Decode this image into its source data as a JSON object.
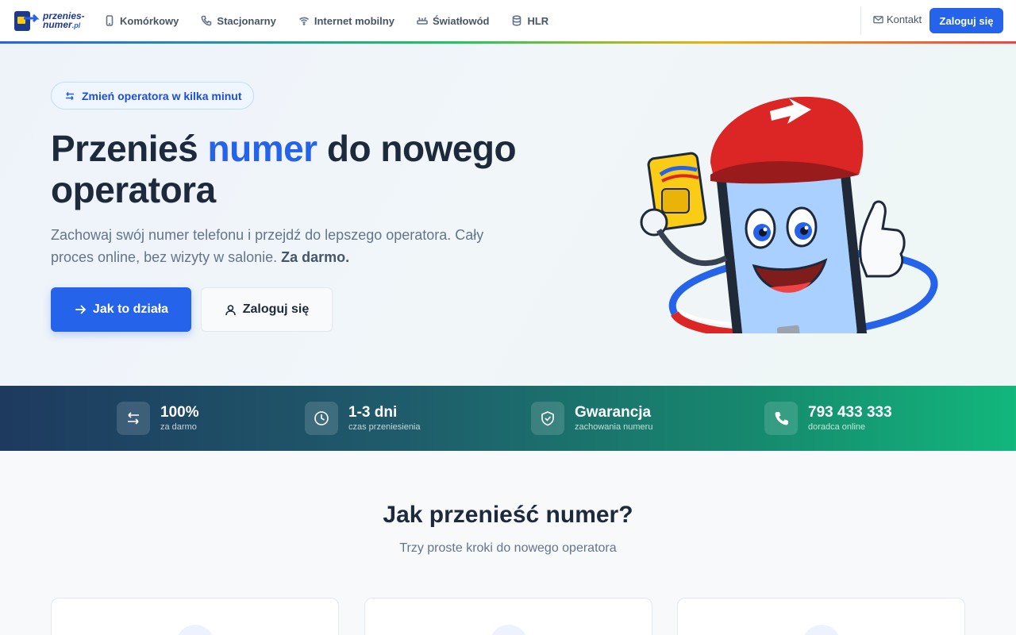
{
  "brand": {
    "logo_line1": "przenies-",
    "logo_line2": "numer",
    "logo_tld": ".pl"
  },
  "nav": {
    "links": [
      {
        "label": "Komórkowy",
        "icon": "mobile-phone-icon"
      },
      {
        "label": "Stacjonarny",
        "icon": "landline-phone-icon"
      },
      {
        "label": "Internet mobilny",
        "icon": "wifi-icon"
      },
      {
        "label": "Światłowód",
        "icon": "router-icon"
      },
      {
        "label": "HLR",
        "icon": "database-icon"
      }
    ],
    "contact_label": "Kontakt",
    "login_label": "Zaloguj się"
  },
  "hero": {
    "badge": "Zmień operatora w kilka minut",
    "title_part1": "Przenieś ",
    "title_accent": "numer",
    "title_part2": " do nowego operatora",
    "subtitle": "Zachowaj swój numer telefonu i przejdź do lepszego operatora. Cały proces online, bez wizyty w salonie. ",
    "subtitle_bold": "Za darmo.",
    "primary_button": "Jak to działa",
    "secondary_button": "Zaloguj się"
  },
  "stats": [
    {
      "value": "100%",
      "label": "za darmo",
      "icon": "swap-arrows-icon"
    },
    {
      "value": "1-3 dni",
      "label": "czas przeniesienia",
      "icon": "clock-icon"
    },
    {
      "value": "Gwarancja",
      "label": "zachowania numeru",
      "icon": "shield-check-icon"
    },
    {
      "value": "793 433 333",
      "label": "doradca online",
      "icon": "phone-icon"
    }
  ],
  "steps": {
    "title": "Jak przenieść numer?",
    "subtitle": "Trzy proste kroki do nowego operatora"
  },
  "colors": {
    "primary": "#2563eb",
    "dark_text": "#1e293b",
    "muted_text": "#64748b",
    "stats_gradient_start": "#1e3a5f",
    "stats_gradient_end": "#12b77c"
  }
}
